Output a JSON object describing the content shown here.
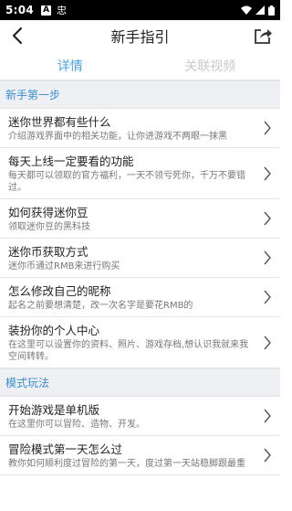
{
  "status": {
    "time": "5:04",
    "box_glyph": "A",
    "carrier_glyph": "忠"
  },
  "nav": {
    "title": "新手指引"
  },
  "tabs": [
    {
      "label": "详情",
      "active": true
    },
    {
      "label": "关联视频",
      "active": false
    }
  ],
  "sections": [
    {
      "title": "新手第一步",
      "items": [
        {
          "title": "迷你世界都有些什么",
          "desc": "介绍游戏界面中的相关功能，让你进游戏不两眼一抹黑"
        },
        {
          "title": "每天上线一定要看的功能",
          "desc": "每天都可以领取的官方福利，一天不领亏死你，千万不要错过。"
        },
        {
          "title": "如何获得迷你豆",
          "desc": "领取迷你豆的黑科技"
        },
        {
          "title": "迷你币获取方式",
          "desc": "迷你币通过RMB来进行购买"
        },
        {
          "title": "怎么修改自己的昵称",
          "desc": "起名之前要想清楚，改一次名字是要花RMB的"
        },
        {
          "title": "装扮你的个人中心",
          "desc": "在这里可以设置你的资料、照片、游戏存档,想认识我就来我空间转转。"
        }
      ]
    },
    {
      "title": "模式玩法",
      "items": [
        {
          "title": "开始游戏是单机版",
          "desc": "在这里你可以冒险、造物、开发。"
        },
        {
          "title": "冒险模式第一天怎么过",
          "desc": "教你如何顺利度过冒险的第一天，度过第一天站稳脚跟最重"
        }
      ]
    }
  ],
  "colors": {
    "accent": "#4aa3df",
    "section_bg": "#eef0f3"
  }
}
